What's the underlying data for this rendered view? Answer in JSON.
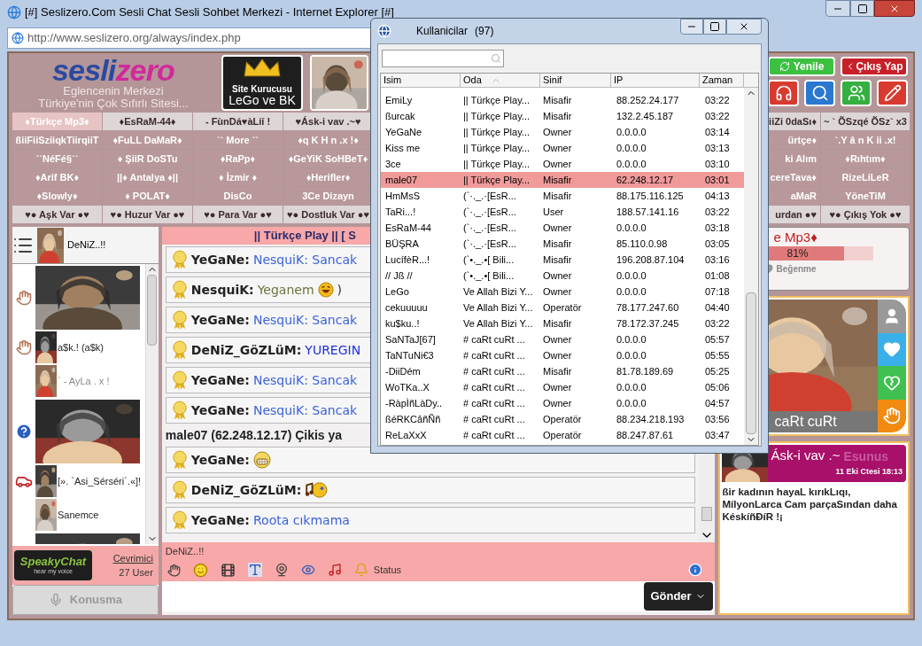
{
  "browser": {
    "title": "[#] Seslizero.Com Sesli Chat Sesli Sohbet Merkezi - Internet Explorer [#]",
    "url": "http://www.seslizero.org/always/index.php"
  },
  "header": {
    "logo_parts": [
      "sesli",
      "zero"
    ],
    "tagline_1": "Eglencenin Merkezi",
    "tagline_2": "Türkiye'nin Çok Sıfırlı Sitesi...",
    "founder_caption": "Site Kurucusu",
    "founder_names": "LeGo ve BK",
    "refresh_button": "Yenile",
    "logout_button": "Çıkış Yap"
  },
  "rooms": [
    {
      "kind": "light",
      "cells": [
        {
          "label": "♦Türkçe Mp3♦",
          "selected": true
        },
        {
          "label": "♦EsRaM-44♦",
          "selected": false
        },
        {
          "label": "- FùnDá♥àLíí !",
          "selected": false
        },
        {
          "label": "♥Ásk-i vav .~♥",
          "selected": false
        },
        {
          "label": "iiZi 0daSı♦",
          "selected": false
        },
        {
          "label": "~ ` ÕSzqé ÕSz` x3",
          "selected": false
        }
      ]
    },
    {
      "kind": "dark",
      "cells": [
        {
          "label": "ßiiFiiSziiqkTiirqiiT",
          "selected": false
        },
        {
          "label": "♦FuLL DaMaR♦",
          "selected": false
        },
        {
          "label": "`` More ``",
          "selected": false
        },
        {
          "label": "♦q K H n .x !♦",
          "selected": false
        },
        {
          "label": "ürtçe♦",
          "selected": false
        },
        {
          "label": "`.Y â n K ii .x!",
          "selected": false
        }
      ]
    },
    {
      "kind": "dark",
      "cells": [
        {
          "label": "``NéFé§``",
          "selected": false
        },
        {
          "label": "♦ ŞiiR DoSTu",
          "selected": false
        },
        {
          "label": "♦RaPp♦",
          "selected": false
        },
        {
          "label": "♦GeYiK SoHBeT♦",
          "selected": false
        },
        {
          "label": "ki Alım",
          "selected": false
        },
        {
          "label": "♦Rıhtım♦",
          "selected": false
        }
      ]
    },
    {
      "kind": "dark",
      "cells": [
        {
          "label": "♦Arif BK♦",
          "selected": false
        },
        {
          "label": "||♦ Antalya ♦||",
          "selected": false
        },
        {
          "label": "♦ İzmir ♦",
          "selected": false
        },
        {
          "label": "♦Herifler♦",
          "selected": false
        },
        {
          "label": "cereTava♦",
          "selected": false
        },
        {
          "label": "RizeLiLeR",
          "selected": false
        }
      ]
    },
    {
      "kind": "dark",
      "cells": [
        {
          "label": "♦Slowly♦",
          "selected": false
        },
        {
          "label": "♦ POLAT♦",
          "selected": false
        },
        {
          "label": "DisCo",
          "selected": false
        },
        {
          "label": "3Ce Dizayn",
          "selected": false
        },
        {
          "label": "aMaR",
          "selected": false
        },
        {
          "label": "YöneTiM",
          "selected": false
        }
      ]
    },
    {
      "kind": "light",
      "cells": [
        {
          "label": "♥● Aşk Var ●♥",
          "selected": false
        },
        {
          "label": "♥● Huzur Var ●♥",
          "selected": false
        },
        {
          "label": "♥● Para Var ●♥",
          "selected": false
        },
        {
          "label": "♥● Dostluk Var ●♥",
          "selected": false
        },
        {
          "label": "urdan ●♥",
          "selected": false
        },
        {
          "label": "♥● Çıkış Yok ●♥",
          "selected": false
        }
      ]
    }
  ],
  "user_panel": {
    "current_user": "DeNiZ..!!",
    "users": [
      {
        "kind": "raisedbanner"
      },
      {
        "kind": "raised",
        "name": "a$k.! (a$k)"
      },
      {
        "kind": "plain",
        "name": "` - AyLa . x !"
      },
      {
        "kind": "helpbanner"
      },
      {
        "kind": "car",
        "name": "[». `Asi_Sérséri´.«]!"
      },
      {
        "kind": "plain",
        "name": "Sanemce"
      },
      {
        "kind": "banner"
      }
    ],
    "brand": "SpeakyChat",
    "brand_tagline": "hear my voice",
    "online_link": "Cevrimici",
    "online_count": "27 User",
    "talk_button": "Konusma"
  },
  "chat": {
    "room_title": "|| Türkçe Play || [ S",
    "messages": [
      {
        "kind": "text",
        "author": "YeGaNe:",
        "text": "NesquiK: Sancak",
        "color": "#3a62d8"
      },
      {
        "kind": "laughing",
        "author": "NesquiK:",
        "text": "Yeganem",
        "tail": ")",
        "color": "#6b7440"
      },
      {
        "kind": "text",
        "author": "YeGaNe:",
        "text": "NesquiK: Sancak",
        "color": "#3a62d8"
      },
      {
        "kind": "text",
        "author": "DeNiZ_GöZLüM:",
        "text": "YUREGIN",
        "color": "#1f2fe0"
      },
      {
        "kind": "text",
        "author": "YeGaNe:",
        "text": "NesquiK: Sancak",
        "color": "#3a62d8"
      },
      {
        "kind": "text",
        "author": "YeGaNe:",
        "text": "NesquiK: Sancak",
        "color": "#3a62d8"
      },
      {
        "kind": "system",
        "text": "male07 (62.248.12.17) Çikis ya"
      },
      {
        "kind": "grinning",
        "author": "YeGaNe:"
      },
      {
        "kind": "singing",
        "author": "DeNiZ_GöZLüM:"
      },
      {
        "kind": "text",
        "author": "YeGaNe:",
        "text": "Roota cıkmama",
        "color": "#3a62d8"
      }
    ],
    "composer_user": "DeNiZ..!!",
    "status_label": "Status",
    "send_button": "Gönder"
  },
  "now_playing": {
    "title": "e Mp3♦",
    "level": 0.81,
    "reading": "81%",
    "dislike": "Beğenme"
  },
  "profile": {
    "name": "caRt cuRt"
  },
  "post": {
    "title": "Ásk-i vav .~",
    "overlay_name": "Esunus",
    "date": "11 Eki Ctesi 18:13",
    "body": "ßir kadının hayaL kırıkLıqı, MílyonLarca Cam parçaSından daha KéskíñĐíR !¡"
  },
  "users_dialog": {
    "title": "Kullanicilar",
    "count": "(97)",
    "columns": [
      "Isim",
      "Oda",
      "Sinif",
      "IP",
      "Zaman"
    ],
    "rows": [
      {
        "name": "EmiLy",
        "room": "|| Türkçe Play...",
        "class": "Misafir",
        "ip": "88.252.24.177",
        "time": "03:22",
        "selected": false
      },
      {
        "name": "ßurcak",
        "room": "|| Türkçe Play...",
        "class": "Misafir",
        "ip": "132.2.45.187",
        "time": "03:22",
        "selected": false
      },
      {
        "name": "YeGaNe",
        "room": "|| Türkçe Play...",
        "class": "Owner",
        "ip": "0.0.0.0",
        "time": "03:14",
        "selected": false
      },
      {
        "name": "Kiss me",
        "room": "|| Türkçe Play...",
        "class": "Owner",
        "ip": "0.0.0.0",
        "time": "03:13",
        "selected": false
      },
      {
        "name": "3ce",
        "room": "|| Türkçe Play...",
        "class": "Owner",
        "ip": "0.0.0.0",
        "time": "03:10",
        "selected": false
      },
      {
        "name": "male07",
        "room": "|| Türkçe Play...",
        "class": "Misafir",
        "ip": "62.248.12.17",
        "time": "03:01",
        "selected": true
      },
      {
        "name": "HmMsS",
        "room": "(`·._.·[EsR...",
        "class": "Misafir",
        "ip": "88.175.116.125",
        "time": "04:13",
        "selected": false
      },
      {
        "name": "TaRi...!",
        "room": "(`·._.·[EsR...",
        "class": "User",
        "ip": "188.57.141.16",
        "time": "03:22",
        "selected": false
      },
      {
        "name": "EsRaM-44",
        "room": "(`·._.·[EsR...",
        "class": "Owner",
        "ip": "0.0.0.0",
        "time": "03:18",
        "selected": false
      },
      {
        "name": "BÜŞRA",
        "room": "(`·._.·[EsR...",
        "class": "Misafir",
        "ip": "85.110.0.98",
        "time": "03:05",
        "selected": false
      },
      {
        "name": "LucífèR...!",
        "room": "(`•._.•[ Bili...",
        "class": "Misafir",
        "ip": "196.208.87.104",
        "time": "03:16",
        "selected": false
      },
      {
        "name": "// Jß //",
        "room": "(`•._.•[ Bili...",
        "class": "Owner",
        "ip": "0.0.0.0",
        "time": "01:08",
        "selected": false
      },
      {
        "name": "LeGo",
        "room": "Ve Allah Bizi Y...",
        "class": "Owner",
        "ip": "0.0.0.0",
        "time": "07:18",
        "selected": false
      },
      {
        "name": "cekuuuuu",
        "room": "Ve Allah Bizi Y...",
        "class": "Operatör",
        "ip": "78.177.247.60",
        "time": "04:40",
        "selected": false
      },
      {
        "name": "ku$ku..!",
        "room": "Ve Allah Bizi Y...",
        "class": "Misafir",
        "ip": "78.172.37.245",
        "time": "03:22",
        "selected": false
      },
      {
        "name": "SaNTaJ[67]",
        "room": "#  caRt cuRt ...",
        "class": "Owner",
        "ip": "0.0.0.0",
        "time": "05:57",
        "selected": false
      },
      {
        "name": "TaNTuNi€3",
        "room": "#  caRt cuRt ...",
        "class": "Owner",
        "ip": "0.0.0.0",
        "time": "05:55",
        "selected": false
      },
      {
        "name": "-DiiDém",
        "room": "#  caRt cuRt ...",
        "class": "Misafir",
        "ip": "81.78.189.69",
        "time": "05:25",
        "selected": false
      },
      {
        "name": "WoTKa..X",
        "room": "#  caRt cuRt ...",
        "class": "Owner",
        "ip": "0.0.0.0",
        "time": "05:06",
        "selected": false
      },
      {
        "name": "-RàpÌñLàDy..",
        "room": "#  caRt cuRt ...",
        "class": "Owner",
        "ip": "0.0.0.0",
        "time": "04:57",
        "selected": false
      },
      {
        "name": "ßéRKCâñÑñ",
        "room": "#  caRt cuRt ...",
        "class": "Operatör",
        "ip": "88.234.218.193",
        "time": "03:56",
        "selected": false
      },
      {
        "name": "ReLaXxX",
        "room": "#  caRt cuRt ...",
        "class": "Operatör",
        "ip": "88.247.87.61",
        "time": "03:47",
        "selected": false
      }
    ]
  }
}
